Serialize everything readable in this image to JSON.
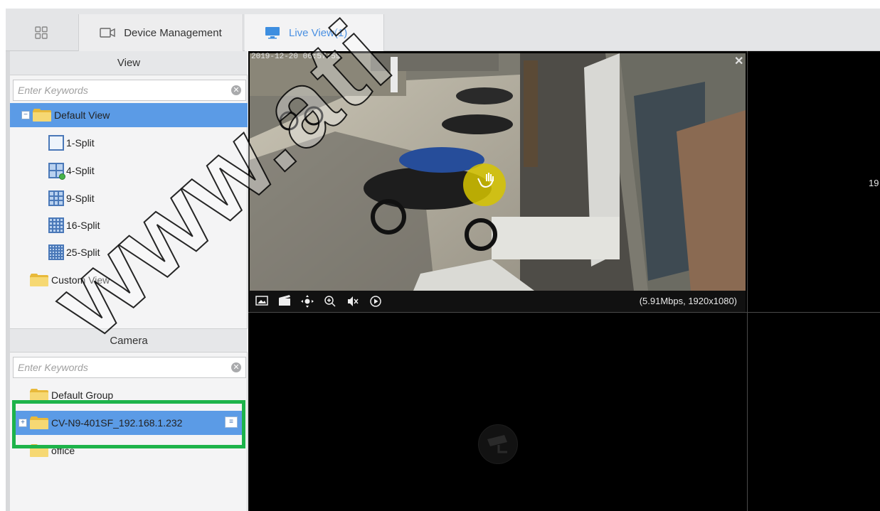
{
  "tabs": {
    "home_icon": "grid-icon",
    "device_management": "Device Management",
    "live_view": "Live View(1)"
  },
  "view_panel": {
    "header": "View",
    "search_placeholder": "Enter Keywords",
    "tree": [
      {
        "label": "Default View",
        "selected": true
      },
      {
        "label": "1-Split"
      },
      {
        "label": "4-Split"
      },
      {
        "label": "9-Split"
      },
      {
        "label": "16-Split"
      },
      {
        "label": "25-Split"
      },
      {
        "label": "Custom View"
      }
    ]
  },
  "camera_panel": {
    "header": "Camera",
    "search_placeholder": "Enter Keywords",
    "tree": [
      {
        "label": "Default Group"
      },
      {
        "label": "CV-N9-401SF_192.168.1.232",
        "selected": true
      },
      {
        "label": "office"
      }
    ]
  },
  "live": {
    "osd_timestamp": "2019-12-20 06:57:59",
    "bitrate_info": "(5.91Mbps, 1920x1080)",
    "cell_number_partial": "19",
    "toolbar_icons": [
      "snapshot-icon",
      "record-icon",
      "ptz-icon",
      "zoom-in-icon",
      "audio-icon",
      "playback-icon"
    ]
  },
  "watermark": "www.ati",
  "colors": {
    "selected_row": "#5b9be6",
    "highlight_box": "#1db34a",
    "live_tab_text": "#4a90e2",
    "folder": "#e8b93a"
  }
}
